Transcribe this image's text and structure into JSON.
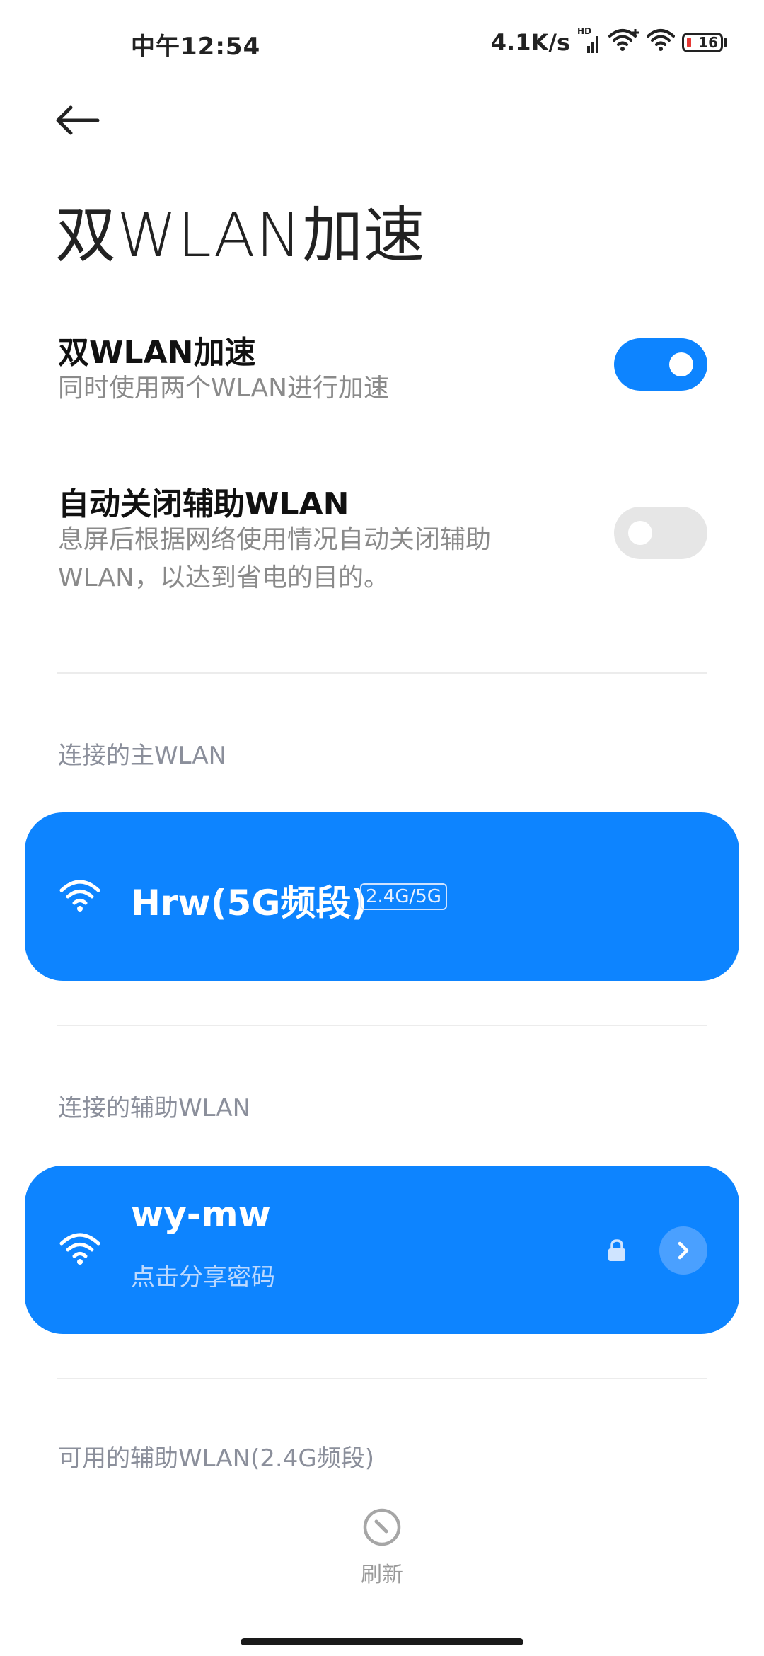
{
  "status_bar": {
    "time": "中午12:54",
    "network_speed": "4.1K/s",
    "signal_label": "HD",
    "battery_level": "16"
  },
  "header": {
    "title": "双WLAN加速"
  },
  "settings": {
    "dual_wlan": {
      "title": "双WLAN加速",
      "subtitle": "同时使用两个WLAN进行加速",
      "enabled": true
    },
    "auto_close": {
      "title": "自动关闭辅助WLAN",
      "subtitle": "息屏后根据网络使用情况自动关闭辅助WLAN，以达到省电的目的。",
      "enabled": false
    }
  },
  "primary_section": {
    "label": "连接的主WLAN",
    "network": {
      "name": "Hrw(5G频段)",
      "band": "2.4G/5G"
    }
  },
  "secondary_section": {
    "label": "连接的辅助WLAN",
    "network": {
      "name": "wy-mw",
      "subtitle": "点击分享密码"
    }
  },
  "available_section": {
    "label": "可用的辅助WLAN(2.4G频段)"
  },
  "refresh": {
    "label": "刷新"
  },
  "colors": {
    "accent": "#0d84ff",
    "toggle_off": "#e6e6e6",
    "section_label": "#8b8f9b"
  }
}
